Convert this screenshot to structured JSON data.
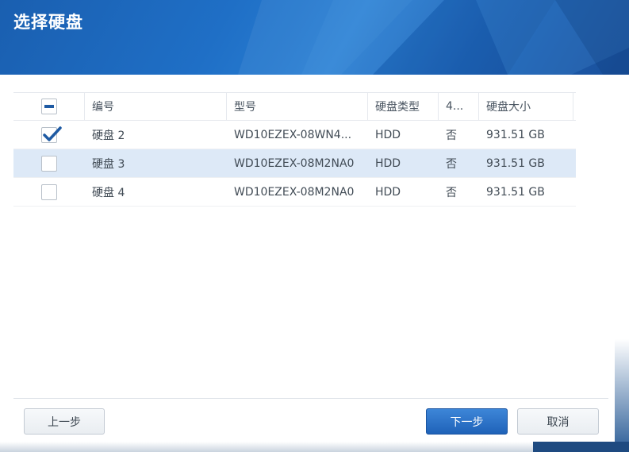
{
  "dialog": {
    "title": "选择硬盘"
  },
  "table": {
    "columns": [
      "编号",
      "型号",
      "硬盘类型",
      "4...",
      "硬盘大小"
    ],
    "select_all_state": "indeterminate",
    "rows": [
      {
        "id": "硬盘 2",
        "model": "WD10EZEX-08WN4...",
        "type": "HDD",
        "col4": "否",
        "size": "931.51 GB",
        "checked": true,
        "selected": false
      },
      {
        "id": "硬盘 3",
        "model": "WD10EZEX-08M2NA0",
        "type": "HDD",
        "col4": "否",
        "size": "931.51 GB",
        "checked": false,
        "selected": true
      },
      {
        "id": "硬盘 4",
        "model": "WD10EZEX-08M2NA0",
        "type": "HDD",
        "col4": "否",
        "size": "931.51 GB",
        "checked": false,
        "selected": false
      }
    ]
  },
  "buttons": {
    "back": "上一步",
    "next": "下一步",
    "cancel": "取消"
  },
  "colors": {
    "accent": "#1f62b8",
    "header": "#1f6fc6",
    "selected_row": "#dde9f7",
    "checkmark": "#1e5aa3"
  }
}
